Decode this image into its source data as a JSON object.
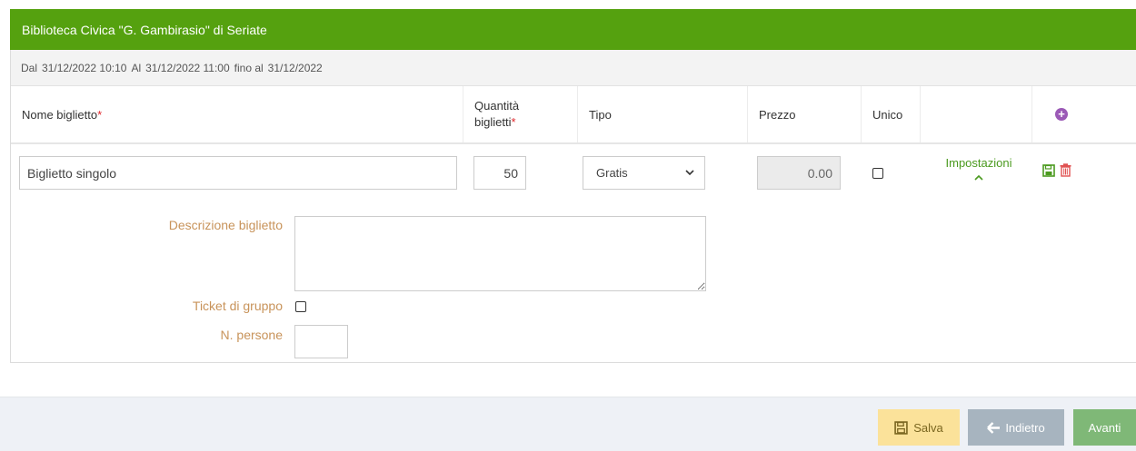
{
  "header": {
    "title": "Biblioteca Civica \"G. Gambirasio\" di Seriate"
  },
  "dates": {
    "dal_label": "Dal",
    "dal_value": "31/12/2022 10:10",
    "al_label": "Al",
    "al_value": "31/12/2022 11:00",
    "fino_label": "fino al",
    "fino_value": "31/12/2022"
  },
  "table": {
    "headers": {
      "nome": "Nome biglietto",
      "quantita_line1": "Quantità",
      "quantita_line2": "biglietti",
      "required_mark": "*",
      "tipo": "Tipo",
      "prezzo": "Prezzo",
      "unico": "Unico"
    },
    "row": {
      "nome": "Biglietto singolo",
      "quantita": "50",
      "tipo": "Gratis",
      "prezzo": "0.00",
      "unico_checked": false,
      "impostazioni": "Impostazioni"
    }
  },
  "details": {
    "descrizione_label": "Descrizione biglietto",
    "descrizione_value": "",
    "gruppo_label": "Ticket di gruppo",
    "gruppo_checked": false,
    "persone_label": "N. persone",
    "persone_value": ""
  },
  "footer": {
    "salva": "Salva",
    "indietro": "Indietro",
    "avanti": "Avanti"
  },
  "colors": {
    "header_green": "#55a10f",
    "label_orange": "#c8935a",
    "required_red": "#e0252a",
    "save_icon_green": "#4b9a1f",
    "delete_icon_red": "#e05252",
    "add_icon_purple": "#9b59b6"
  },
  "icons": {
    "add": "plus-circle-icon",
    "save": "floppy-disk-icon",
    "delete": "trash-icon",
    "impostazioni_toggle": "chevron-up-icon",
    "tipo_dropdown": "chevron-down-icon",
    "back": "arrow-left-icon"
  }
}
